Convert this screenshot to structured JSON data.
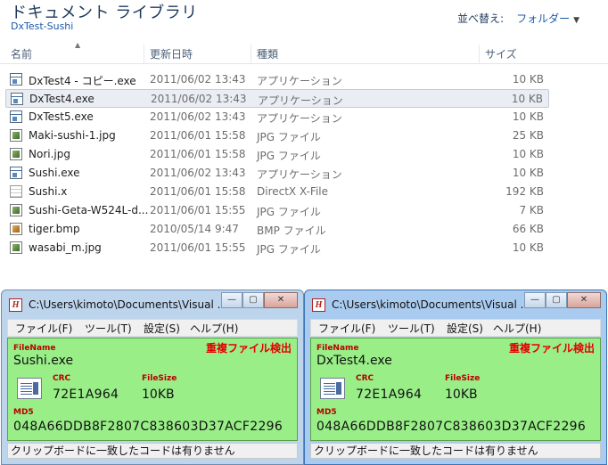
{
  "library": {
    "title": "ドキュメント ライブラリ",
    "subtitle": "DxTest-Sushi",
    "arrange_label": "並べ替え:",
    "arrange_value": "フォルダー"
  },
  "columns": {
    "name": "名前",
    "date": "更新日時",
    "type": "種類",
    "size": "サイズ"
  },
  "files": [
    {
      "name": "DxTest4 - コピー.exe",
      "date": "2011/06/02 13:43",
      "type": "アプリケーション",
      "size": "10 KB",
      "icon": "exe-icon"
    },
    {
      "name": "DxTest4.exe",
      "date": "2011/06/02 13:43",
      "type": "アプリケーション",
      "size": "10 KB",
      "icon": "exe-icon",
      "selected": true
    },
    {
      "name": "DxTest5.exe",
      "date": "2011/06/02 13:43",
      "type": "アプリケーション",
      "size": "10 KB",
      "icon": "exe-icon"
    },
    {
      "name": "Maki-sushi-1.jpg",
      "date": "2011/06/01 15:58",
      "type": "JPG ファイル",
      "size": "25 KB",
      "icon": "jpg-icon"
    },
    {
      "name": "Nori.jpg",
      "date": "2011/06/01 15:58",
      "type": "JPG ファイル",
      "size": "10 KB",
      "icon": "jpg-icon"
    },
    {
      "name": "Sushi.exe",
      "date": "2011/06/02 13:43",
      "type": "アプリケーション",
      "size": "10 KB",
      "icon": "exe-icon"
    },
    {
      "name": "Sushi.x",
      "date": "2011/06/01 15:58",
      "type": "DirectX X-File",
      "size": "192 KB",
      "icon": "document-icon"
    },
    {
      "name": "Sushi-Geta-W524L-d...",
      "date": "2011/06/01 15:55",
      "type": "JPG ファイル",
      "size": "7 KB",
      "icon": "jpg-icon"
    },
    {
      "name": "tiger.bmp",
      "date": "2010/05/14 9:47",
      "type": "BMP ファイル",
      "size": "66 KB",
      "icon": "bmp-icon"
    },
    {
      "name": "wasabi_m.jpg",
      "date": "2011/06/01 15:55",
      "type": "JPG ファイル",
      "size": "10 KB",
      "icon": "jpg-icon"
    }
  ],
  "windows": [
    {
      "title": "C:\\Users\\kimoto\\Documents\\Visual ...",
      "menu": [
        "ファイル(F)",
        "ツール(T)",
        "設定(S)",
        "ヘルプ(H)"
      ],
      "filename_label": "FileName",
      "filename": "Sushi.exe",
      "dup_label": "重複ファイル検出",
      "crc_label": "CRC",
      "crc": "72E1A964",
      "filesize_label": "FileSize",
      "filesize": "10KB",
      "md5_label": "MD5",
      "md5": "048A66DDB8F2807C838603D37ACF2296",
      "status": "クリップボードに一致したコードは有りません"
    },
    {
      "title": "C:\\Users\\kimoto\\Documents\\Visual ...",
      "menu": [
        "ファイル(F)",
        "ツール(T)",
        "設定(S)",
        "ヘルプ(H)"
      ],
      "filename_label": "FileName",
      "filename": "DxTest4.exe",
      "dup_label": "重複ファイル検出",
      "crc_label": "CRC",
      "crc": "72E1A964",
      "filesize_label": "FileSize",
      "filesize": "10KB",
      "md5_label": "MD5",
      "md5": "048A66DDB8F2807C838603D37ACF2296",
      "status": "クリップボードに一致したコードは有りません"
    }
  ],
  "caption_buttons": {
    "minimize": "—",
    "maximize": "▢",
    "close": "✕"
  },
  "colors": {
    "panel_green": "#99ee88",
    "dup_red": "#e40000",
    "label_red": "#b80000"
  }
}
